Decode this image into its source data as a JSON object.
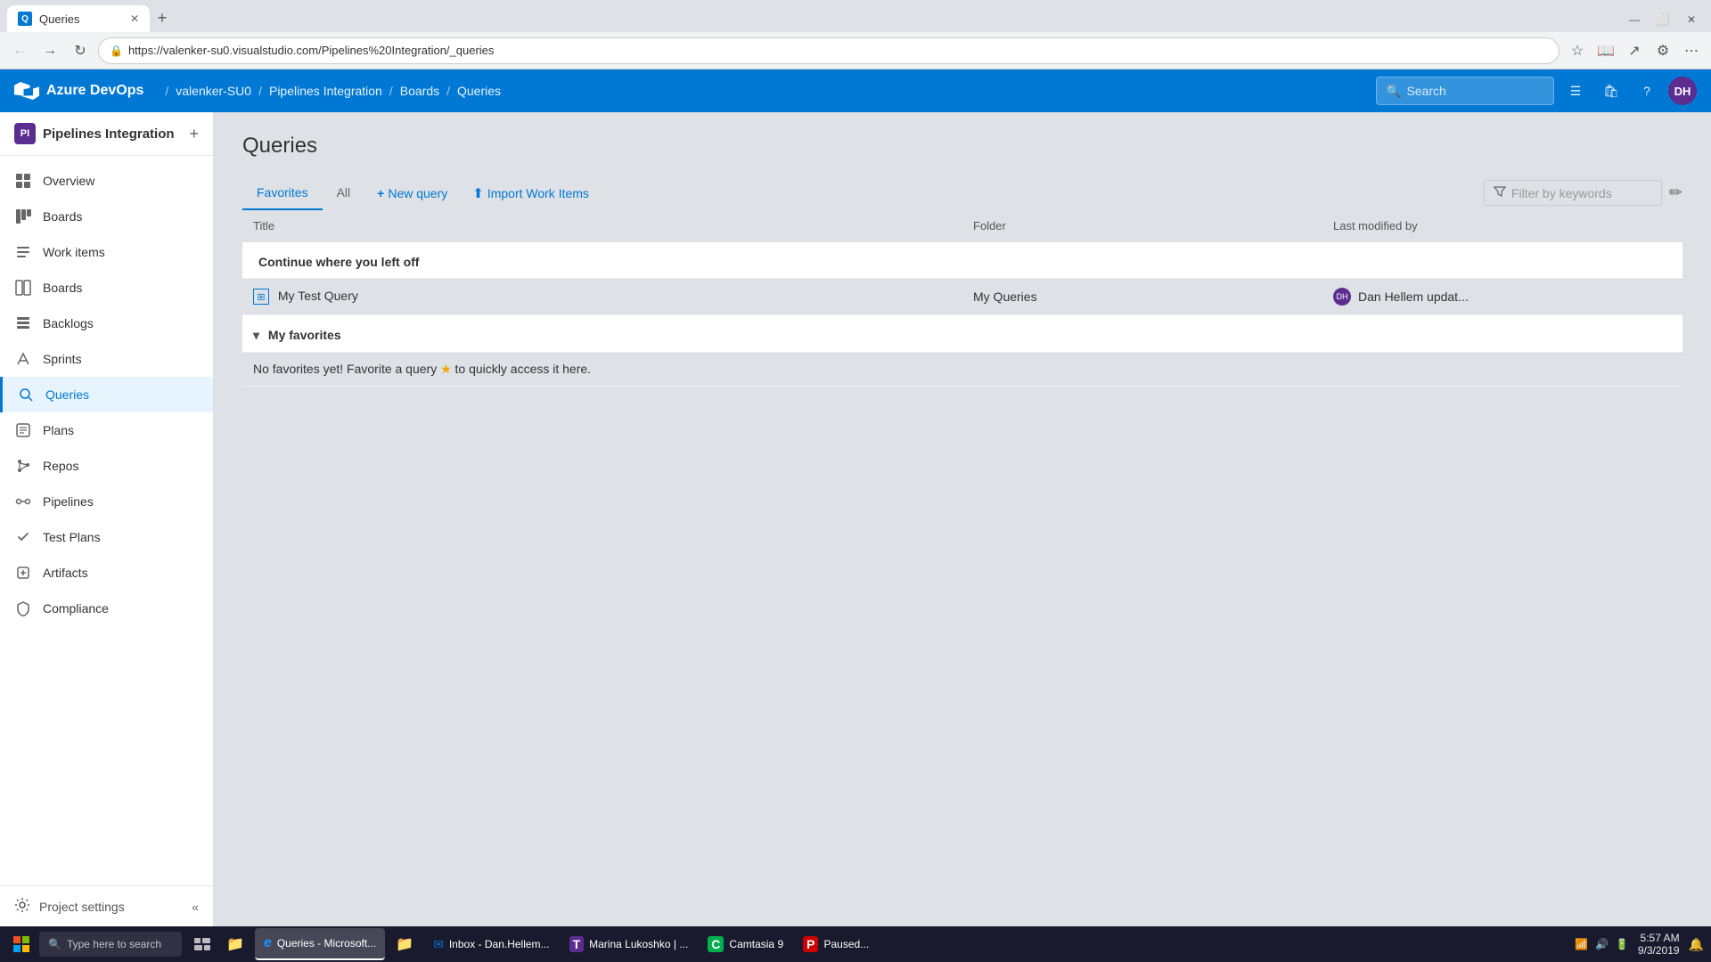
{
  "browser": {
    "tab_label": "Queries",
    "tab_favicon": "Q",
    "url": "https://valenker-su0.visualstudio.com/Pipelines%20Integration/_queries",
    "new_tab_label": "+"
  },
  "header": {
    "logo_text": "Azure DevOps",
    "nav": {
      "org": "valenker-SU0",
      "project": "Pipelines Integration",
      "section": "Boards",
      "page": "Queries"
    },
    "search_placeholder": "Search",
    "avatar_initials": "DH"
  },
  "sidebar": {
    "project_name": "Pipelines Integration",
    "project_initials": "PI",
    "add_label": "+",
    "nav_items": [
      {
        "id": "overview",
        "label": "Overview",
        "icon": "⊞"
      },
      {
        "id": "boards",
        "label": "Boards",
        "icon": "▦"
      },
      {
        "id": "work-items",
        "label": "Work items",
        "icon": "☰"
      },
      {
        "id": "boards2",
        "label": "Boards",
        "icon": "⊠"
      },
      {
        "id": "backlogs",
        "label": "Backlogs",
        "icon": "≡"
      },
      {
        "id": "sprints",
        "label": "Sprints",
        "icon": "⚡"
      },
      {
        "id": "queries",
        "label": "Queries",
        "icon": "⊞",
        "active": true
      },
      {
        "id": "plans",
        "label": "Plans",
        "icon": "📋"
      },
      {
        "id": "repos",
        "label": "Repos",
        "icon": "⎇"
      },
      {
        "id": "pipelines",
        "label": "Pipelines",
        "icon": "⚙"
      },
      {
        "id": "test-plans",
        "label": "Test Plans",
        "icon": "✓"
      },
      {
        "id": "artifacts",
        "label": "Artifacts",
        "icon": "📦"
      },
      {
        "id": "compliance",
        "label": "Compliance",
        "icon": "🛡"
      }
    ],
    "footer": {
      "settings_label": "Project settings",
      "collapse_icon": "«"
    }
  },
  "content": {
    "page_title": "Queries",
    "tabs": [
      {
        "id": "favorites",
        "label": "Favorites",
        "active": true
      },
      {
        "id": "all",
        "label": "All"
      }
    ],
    "actions": [
      {
        "id": "new-query",
        "label": "New query",
        "icon": "+"
      },
      {
        "id": "import-work-items",
        "label": "Import Work Items",
        "icon": "⬆"
      }
    ],
    "filter_placeholder": "Filter by keywords",
    "table": {
      "columns": [
        {
          "id": "title",
          "label": "Title"
        },
        {
          "id": "folder",
          "label": "Folder"
        },
        {
          "id": "modified",
          "label": "Last modified by"
        }
      ],
      "sections": [
        {
          "id": "continue-left-off",
          "label": "Continue where you left off",
          "rows": [
            {
              "title": "My Test Query",
              "folder": "My Queries",
              "modified_by": "Dan Hellem updat...",
              "modified_avatar": "DH"
            }
          ]
        },
        {
          "id": "my-favorites",
          "label": "My favorites",
          "rows": [],
          "empty_message": "No favorites yet! Favorite a query",
          "empty_message_suffix": " to quickly access it here."
        }
      ]
    }
  },
  "taskbar": {
    "search_placeholder": "Type here to search",
    "apps": [
      {
        "id": "file-explorer",
        "label": "",
        "icon": "📁",
        "active": false
      },
      {
        "id": "ie",
        "label": "Queries - Microsoft...",
        "icon": "e",
        "active": true,
        "color": "#1e90ff"
      },
      {
        "id": "folder2",
        "label": "",
        "icon": "📁",
        "active": false
      },
      {
        "id": "outlook",
        "label": "Inbox - Dan.Hellem...",
        "icon": "✉",
        "active": false,
        "color": "#0078d4"
      },
      {
        "id": "teams",
        "label": "Marina Lukoshko | ...",
        "icon": "T",
        "active": false,
        "color": "#5c2d91"
      },
      {
        "id": "camtasia",
        "label": "Camtasia 9",
        "icon": "C",
        "active": false,
        "color": "#00b050"
      },
      {
        "id": "paused",
        "label": "Paused...",
        "icon": "P",
        "active": false,
        "color": "#c00"
      }
    ],
    "time": "5:57 AM",
    "date": "9/3/2019"
  }
}
